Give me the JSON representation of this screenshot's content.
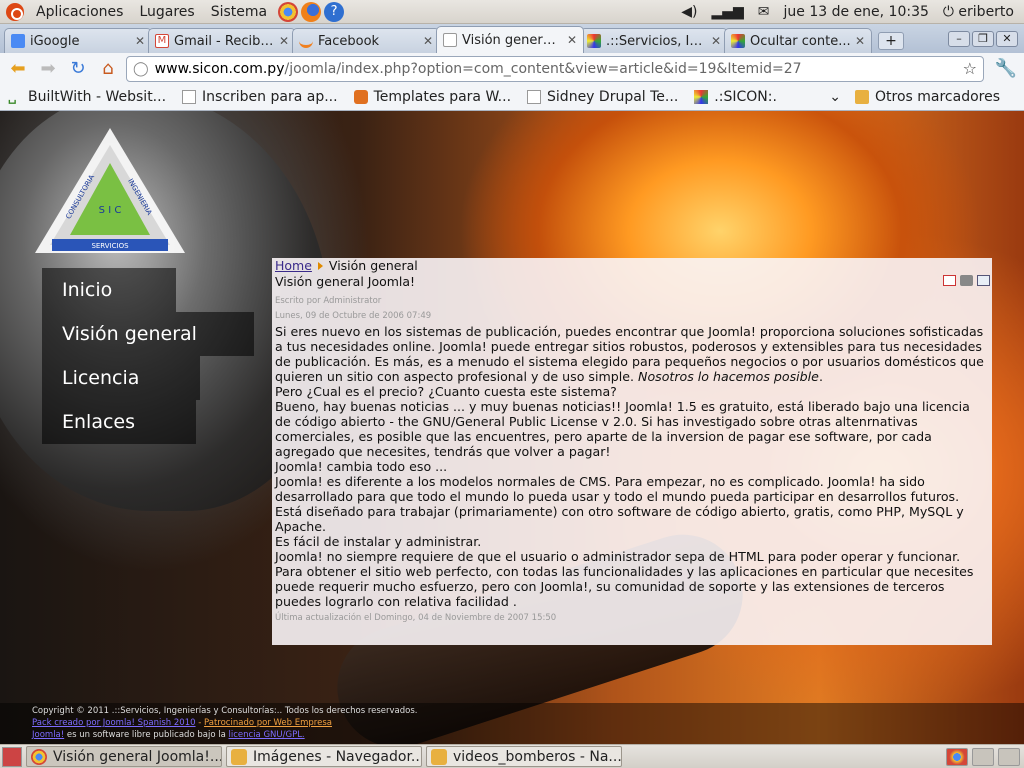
{
  "top_panel": {
    "menus": [
      "Aplicaciones",
      "Lugares",
      "Sistema"
    ],
    "clock": "jue 13 de ene, 10:35",
    "user": "eriberto"
  },
  "tabs": [
    {
      "title": "iGoogle",
      "color": "#4a8af4"
    },
    {
      "title": "Gmail - Recibi...",
      "color": "#d44638"
    },
    {
      "title": "Facebook",
      "color": "#f08020"
    },
    {
      "title": "Visión general...",
      "color": "#ffffff"
    },
    {
      "title": ".::Servicios, In...",
      "color": "#333333"
    },
    {
      "title": "Ocultar conte...",
      "color": "#333333"
    }
  ],
  "omnibox": {
    "host": "www.sicon.com.py",
    "path": "/joomla/index.php?option=com_content&view=article&id=19&Itemid=27"
  },
  "bookmarks": [
    "BuiltWith - Websit...",
    "Inscriben para ap...",
    "Templates para W...",
    "Sidney Drupal Te...",
    ".:SICON:."
  ],
  "bookmarks_more": "Otros marcadores",
  "site": {
    "menu": [
      "Inicio",
      "Visión general",
      "Licencia",
      "Enlaces"
    ],
    "logo": {
      "top_left": "CONSULTORIA",
      "top_right": "INGENIERIA",
      "bottom": "SERVICIOS",
      "letters": "S I C"
    },
    "breadcrumb_home": "Home",
    "breadcrumb_current": "Visión general",
    "article_title": "Visión general Joomla!",
    "author": "Escrito por Administrator",
    "date": "Lunes, 09 de Octubre de 2006 07:49",
    "para1a": "Si eres nuevo en los sistemas de publicación, puedes encontrar que Joomla! proporciona soluciones sofisticadas a tus necesidades online. Joomla! puede entregar sitios robustos, poderosos y extensibles para tus necesidades de publicación. Es más, es a menudo el sistema elegido para pequeños negocios o por usuarios domésticos que quieren un sitio con aspecto profesional y de uso simple.",
    "para1b": "Nosotros lo hacemos posible",
    "para2": "Pero ¿Cual es el precio? ¿Cuanto cuesta este sistema?",
    "para3": "Bueno, hay buenas noticias ... y muy buenas noticias!! Joomla! 1.5 es gratuito, está liberado bajo una licencia de código abierto - the GNU/General Public License v 2.0. Si has investigado sobre otras altenrnativas comerciales, es posible que las encuentres, pero aparte de la inversion de pagar ese software, por cada agregado que necesites, tendrás que volver a pagar!",
    "para4": "Joomla! cambia todo eso ...",
    "para5": "Joomla! es diferente a los modelos normales de CMS. Para empezar, no es complicado. Joomla! ha sido desarrollado para que todo el mundo lo pueda usar y todo el mundo pueda participar en desarrollos futuros. Está diseñado para trabajar (primariamente) con otro software de código abierto, gratis, como PHP, MySQL y Apache.",
    "para6": "Es fácil de instalar y administrar.",
    "para7": "Joomla! no siempre requiere de que el usuario o administrador sepa de HTML para poder operar y funcionar.",
    "para8": "Para obtener el sitio web perfecto, con todas las funcionalidades y las aplicaciones en particular que necesites puede requerir mucho esfuerzo, pero con Joomla!, su comunidad de soporte y las extensiones de terceros puedes lograrlo con relativa facilidad .",
    "updated": "Última actualización el Domingo, 04 de Noviembre de 2007 15:50",
    "footer_copyright": "Copyright © 2011 .::Servicios, Ingenierías y Consultorías:.. Todos los derechos reservados.",
    "footer_pack": "Pack creado por Joomla! Spanish 2010",
    "footer_sep": " - ",
    "footer_sponsor": "Patrocinado por Web Empresa",
    "footer_joomla": "Joomla!",
    "footer_text": " es un software libre publicado bajo la ",
    "footer_license": "licencia GNU/GPL."
  },
  "taskbar": [
    "Visión general Joomla!...",
    "Imágenes - Navegador...",
    "videos_bomberos - Na..."
  ]
}
